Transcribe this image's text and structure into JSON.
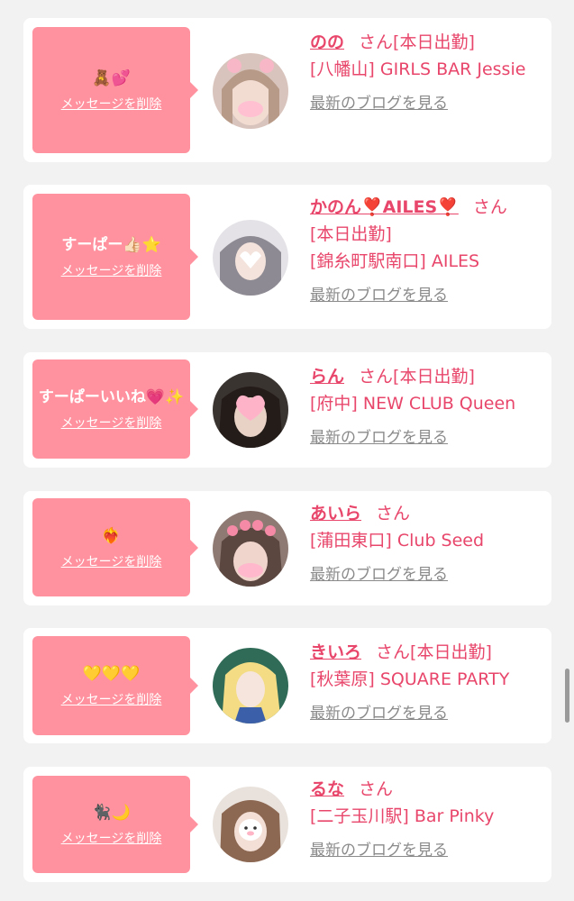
{
  "delete_label": "メッセージを削除",
  "blog_label": "最新のブログを見る",
  "san_label": "さん",
  "cards": [
    {
      "message": "🧸💕",
      "name": "のの",
      "status": "[本日出勤]",
      "shop": "[八幡山] GIRLS BAR Jessie"
    },
    {
      "message": "すーぱー👍🏻⭐️",
      "name": "かのん❣️AILES❣️",
      "status": "[本日出勤]",
      "shop": "[錦糸町駅南口] AILES"
    },
    {
      "message": "すーぱーいいね💗✨",
      "name": "らん",
      "status": "[本日出勤]",
      "shop": "[府中] NEW CLUB Queen"
    },
    {
      "message": "❤️‍🔥",
      "name": "あいら",
      "status": "",
      "shop": "[蒲田東口] Club Seed"
    },
    {
      "message": "💛💛💛",
      "name": "きいろ",
      "status": "[本日出勤]",
      "shop": "[秋葉原] SQUARE PARTY"
    },
    {
      "message": "🐈‍⬛🌙",
      "name": "るな",
      "status": "",
      "shop": "[二子玉川駅] Bar Pinky"
    }
  ]
}
